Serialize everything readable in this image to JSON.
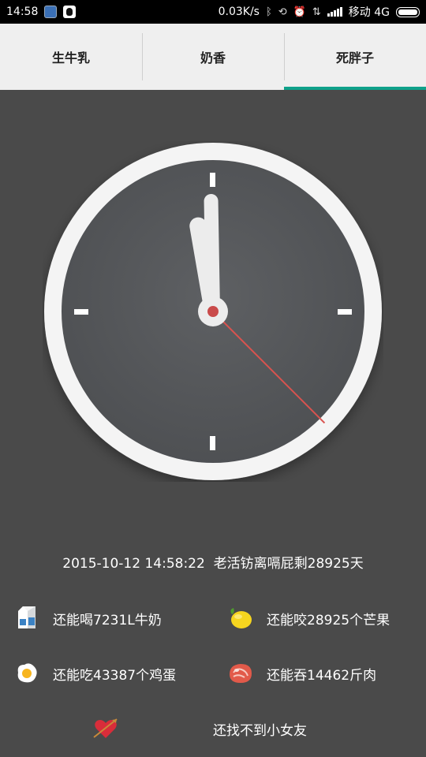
{
  "status_bar": {
    "time": "14:58",
    "net_speed": "0.03K/s",
    "carrier": "移动 4G"
  },
  "tabs": [
    {
      "label": "生牛乳",
      "active": false
    },
    {
      "label": "奶香",
      "active": false
    },
    {
      "label": "死胖子",
      "active": true
    }
  ],
  "clock": {
    "hour": 11,
    "minute": 58,
    "second": 22,
    "colors": {
      "face": "#57595c",
      "rim": "#ffffff",
      "hands": "#ececec",
      "second_hand": "#d9534f"
    }
  },
  "summary": {
    "datetime": "2015-10-12 14:58:22",
    "remaining": "老活钫离嗝屁剩28925天"
  },
  "stats": {
    "milk": {
      "text": "还能喝7231L牛奶",
      "icon": "milk-carton-icon"
    },
    "mango": {
      "text": "还能咬28925个芒果",
      "icon": "mango-icon"
    },
    "egg": {
      "text": "还能吃43387个鸡蛋",
      "icon": "fried-egg-icon"
    },
    "meat": {
      "text": "还能吞14462斤肉",
      "icon": "steak-icon"
    },
    "love": {
      "text": "还找不到小女友",
      "icon": "heart-arrow-icon"
    }
  }
}
